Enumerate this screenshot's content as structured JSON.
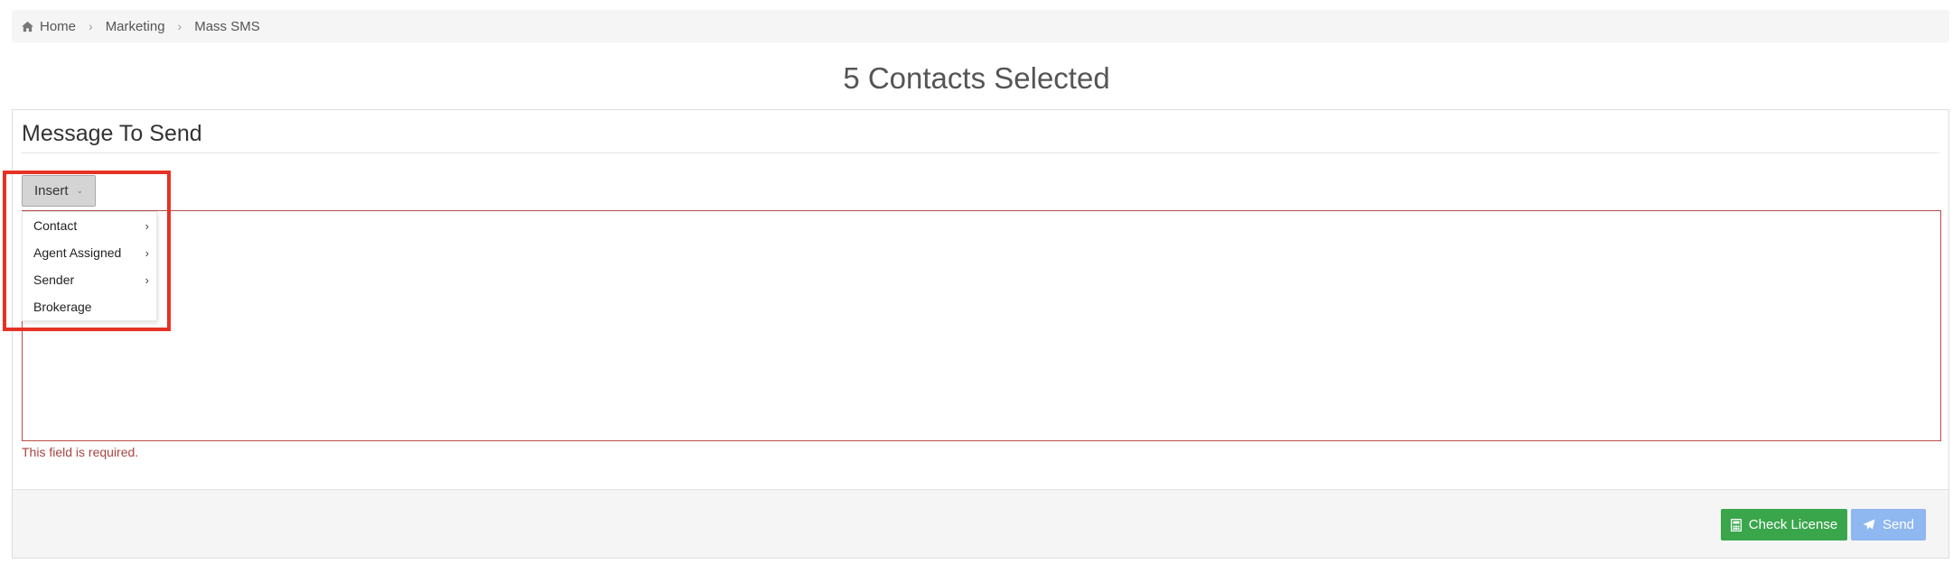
{
  "breadcrumb": {
    "items": [
      "Home",
      "Marketing",
      "Mass SMS"
    ],
    "separator": "›"
  },
  "page": {
    "title": "5 Contacts Selected"
  },
  "panel": {
    "heading": "Message To Send",
    "insert_button": "Insert",
    "insert_caret": "⌄",
    "dropdown_items": [
      {
        "label": "Contact",
        "arrow": "›"
      },
      {
        "label": "Agent Assigned",
        "arrow": "›"
      },
      {
        "label": "Sender",
        "arrow": "›"
      },
      {
        "label": "Brokerage",
        "arrow": ""
      }
    ],
    "error_text": "This field is required."
  },
  "footer": {
    "check_license_label": "Check License",
    "send_label": "Send"
  },
  "colors": {
    "success": "#3aa64c",
    "primary_disabled": "#8fb7f0",
    "error": "#a94442",
    "highlight": "#e53225"
  },
  "icons": {
    "home": "home-icon",
    "calculator": "calculator-icon",
    "paper_plane": "paper-plane-icon"
  }
}
